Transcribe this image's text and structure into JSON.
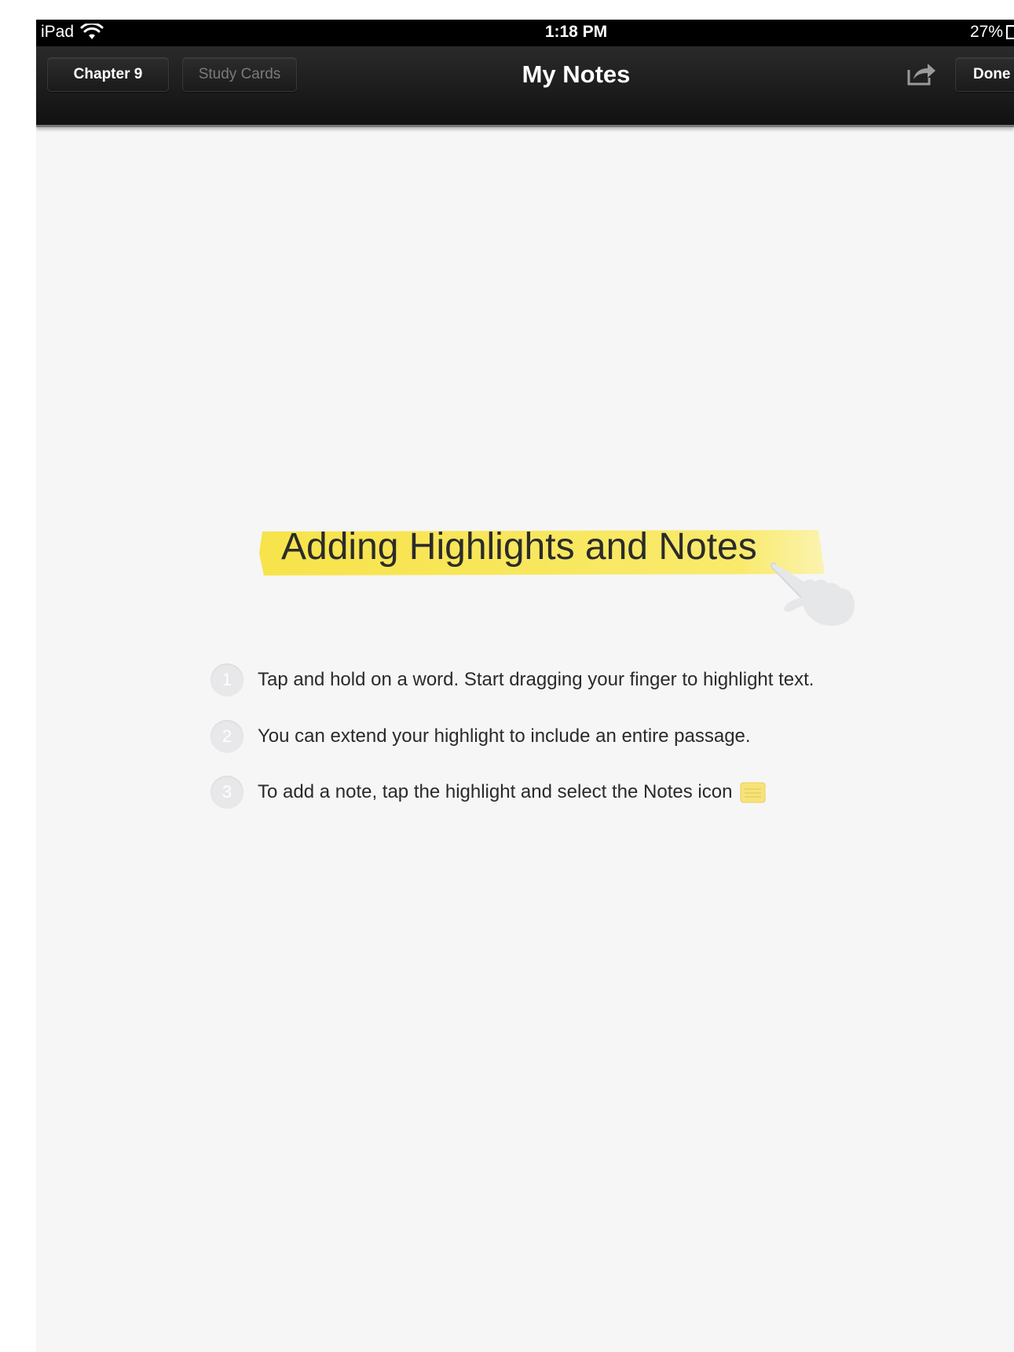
{
  "status_bar": {
    "carrier": "iPad",
    "time": "1:18 PM",
    "battery": "27%",
    "wifi_icon": "wifi-icon",
    "battery_icon": "battery-icon"
  },
  "toolbar": {
    "title": "My Notes",
    "chapter_label": "Chapter 9",
    "study_cards_label": "Study Cards",
    "done_label": "Done",
    "share_icon": "share-icon"
  },
  "content": {
    "heading": "Adding Highlights and Notes",
    "hand_icon": "pointing-hand-icon",
    "steps": [
      {
        "number": "1",
        "text": "Tap and hold on a word. Start dragging your finger to highlight text."
      },
      {
        "number": "2",
        "text": "You can extend your highlight to include an entire passage."
      },
      {
        "number": "3",
        "text": "To add a note, tap the highlight and select the Notes icon",
        "icon": "notes-icon"
      }
    ]
  },
  "colors": {
    "highlight": "#f7e55a",
    "background": "#f6f6f6",
    "toolbar": "#1a1a1a",
    "disabled_text": "#7a7a7a"
  }
}
